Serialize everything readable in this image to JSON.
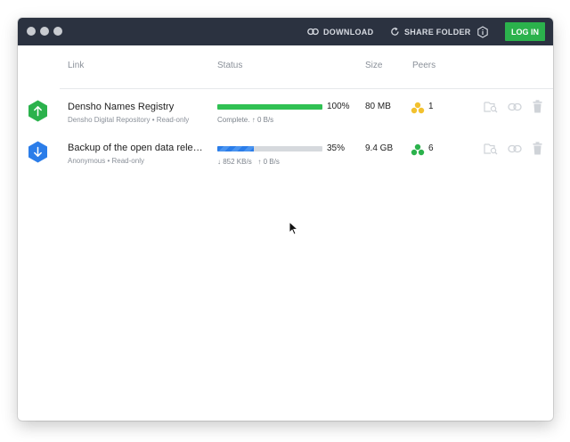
{
  "toolbar": {
    "download_label": "DOWNLOAD",
    "share_label": "SHARE FOLDER",
    "login_label": "LOG IN"
  },
  "columns": {
    "link": "Link",
    "status": "Status",
    "size": "Size",
    "peers": "Peers"
  },
  "rows": [
    {
      "title": "Densho Names Registry",
      "owner": "Densho Digital Repository",
      "mode": "Read-only",
      "direction": "upload",
      "progress": 1.0,
      "percent": "100%",
      "status_text": "Complete.",
      "up_rate": "0 B/s",
      "size": "80 MB",
      "peers": "1",
      "peer_color": "#f2c12e",
      "hex_color": "#2bb24c"
    },
    {
      "title": "Backup of the open data rele…",
      "owner": "Anonymous",
      "mode": "Read-only",
      "direction": "download",
      "progress": 0.35,
      "percent": "35%",
      "down_rate": "852 KB/s",
      "up_rate": "0 B/s",
      "size": "9.4 GB",
      "peers": "6",
      "peer_color": "#2bb24c",
      "hex_color": "#2b7de9"
    }
  ],
  "icons": [
    "link-icon",
    "share-folder-icon",
    "info-icon",
    "arrow-up-icon",
    "arrow-down-icon",
    "peers-icon",
    "inspect-icon",
    "link-copy-icon",
    "trash-icon",
    "mouse-cursor-icon"
  ],
  "colors": {
    "titlebar": "#2b3240",
    "login": "#2bb24c",
    "progress_complete": "#30c153",
    "progress_downloading": "#2b7de9"
  }
}
